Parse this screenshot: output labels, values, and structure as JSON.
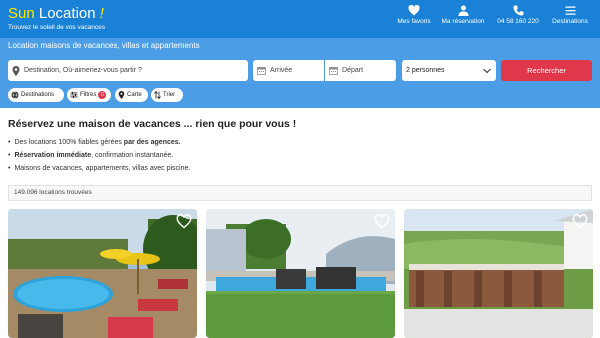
{
  "header": {
    "logo_sun": "Sun",
    "logo_location": " Location",
    "logo_bang": " !",
    "tagline": "Trouvez le soleil de vos vacances",
    "nav": {
      "favorites": "Mes favoris",
      "reservation": "Ma réservation",
      "phone": "04 58 160 220",
      "destinations": "Destinations"
    }
  },
  "search": {
    "subtitle": "Location maisons de vacances, villas et appartements",
    "destination_placeholder": "Destination, Où-aimeriez-vous partir ?",
    "arrival_placeholder": "Arrivée",
    "departure_placeholder": "Départ",
    "guests_value": "2 personnes",
    "submit_label": "Rechercher",
    "chips": {
      "destinations": "Destinations",
      "filters": "Filtres",
      "filters_count": "0",
      "map": "Carte",
      "sort": "Trier"
    }
  },
  "main": {
    "headline": "Réservez une maison de vacances ... rien que pour vous !",
    "bullet1_pre": "Des locations 100% fiables gérées ",
    "bullet1_strong": "par des agences.",
    "bullet2_strong": "Réservation immédiate",
    "bullet2_post": ", confirmation instantanée.",
    "bullet3": "Maisons de vacances, appartements, villas avec piscine.",
    "results_count": "149.096 locations trouvées"
  },
  "colors": {
    "header": "#1a82d6",
    "search_band": "#4b9de6",
    "cta": "#e0374a",
    "logo_accent": "#ffe500"
  }
}
